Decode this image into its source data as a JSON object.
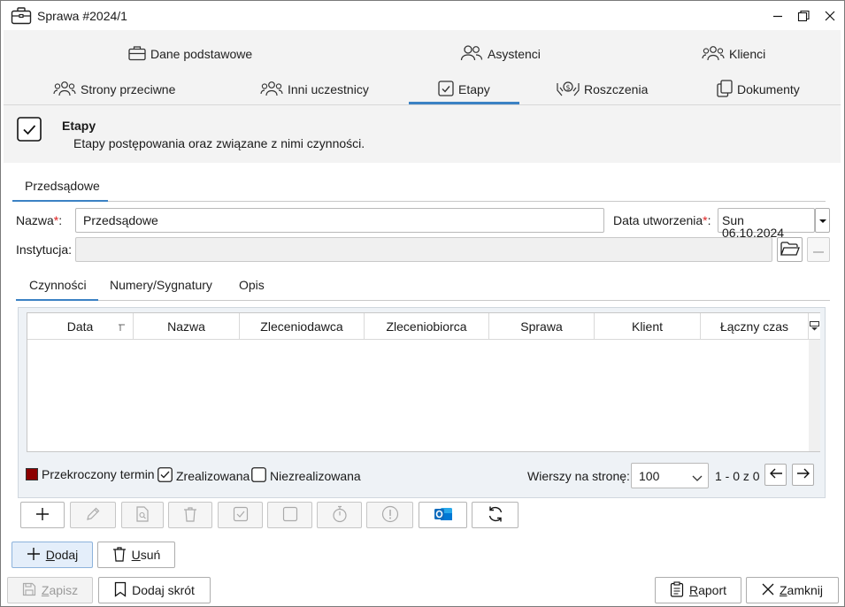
{
  "window": {
    "title": "Sprawa #2024/1",
    "controls": [
      "minimize-icon",
      "restore-icon",
      "close-icon"
    ]
  },
  "tabs": {
    "row1": [
      "Dane podstawowe",
      "Asystenci",
      "Klienci"
    ],
    "row2": [
      "Strony przeciwne",
      "Inni uczestnicy",
      "Etapy",
      "Roszczenia",
      "Dokumenty"
    ],
    "active": "Etapy"
  },
  "section_header": {
    "title": "Etapy",
    "description": "Etapy postępowania oraz związane z nimi czynności."
  },
  "stage_tabs": [
    "Przedsądowe"
  ],
  "form": {
    "name_label": "Nazwa",
    "name_req": "*",
    "name_colon": ":",
    "name_value": "Przedsądowe",
    "date_label": "Data utworzenia",
    "date_req": "*",
    "date_colon": ":",
    "date_value": "Sun 06.10.2024",
    "institution_label": "Instytucja:",
    "institution_value": ""
  },
  "detail_tabs": [
    "Czynności",
    "Numery/Sygnatury",
    "Opis"
  ],
  "grid": {
    "columns": [
      "Data",
      "Nazwa",
      "Zleceniodawca",
      "Zleceniobiorca",
      "Sprawa",
      "Klient",
      "Łączny czas"
    ]
  },
  "legend": {
    "overdue": "Przekroczony termin",
    "overdue_color": "#8b0000",
    "done": "Zrealizowana",
    "done_checked": true,
    "not_done": "Niezrealizowana",
    "not_done_checked": false
  },
  "pagination": {
    "rows_label": "Wierszy na stronę:",
    "rows_value": "100",
    "range": "1 - 0 z 0"
  },
  "toolbar": {
    "items": [
      "add-icon",
      "edit-icon",
      "preview-icon",
      "delete-icon",
      "check-icon",
      "square-icon",
      "stopwatch-icon",
      "alert-icon",
      "outlook-icon",
      "refresh-icon"
    ]
  },
  "actions": {
    "add": "Dodaj",
    "add_underline": "D",
    "add_rest": "odaj",
    "remove": "Usuń",
    "remove_underline": "U",
    "remove_rest": "suń",
    "save_underline": "Z",
    "save_rest": "apisz",
    "shortcut": "Dodaj skrót",
    "report_underline": "R",
    "report_rest": "aport",
    "close_underline": "Z",
    "close_rest": "amknij"
  },
  "colors": {
    "accent": "#3b82c4",
    "outlook": "#0f6cbd"
  }
}
